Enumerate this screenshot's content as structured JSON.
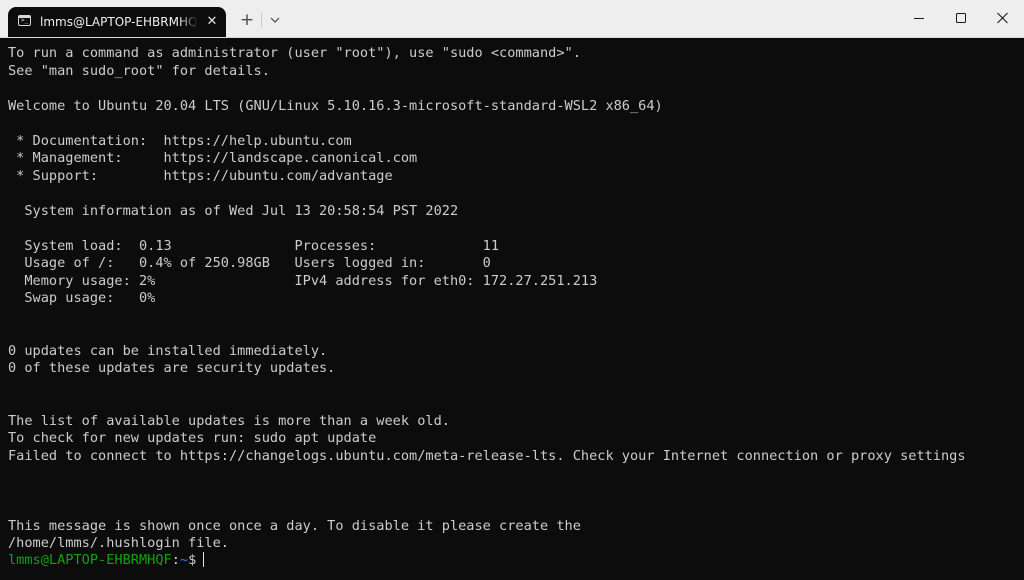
{
  "window": {
    "tab_title": "lmms@LAPTOP-EHBRMHQF: ~",
    "tab_icon": "terminal-icon",
    "tab_close_icon": "close-icon",
    "new_tab_icon": "plus-icon",
    "dropdown_icon": "chevron-down-icon",
    "controls": [
      "minimize-icon",
      "maximize-icon",
      "close-icon"
    ]
  },
  "terminal": {
    "lines": [
      "To run a command as administrator (user \"root\"), use \"sudo <command>\".",
      "See \"man sudo_root\" for details.",
      "",
      "Welcome to Ubuntu 20.04 LTS (GNU/Linux 5.10.16.3-microsoft-standard-WSL2 x86_64)",
      "",
      " * Documentation:  https://help.ubuntu.com",
      " * Management:     https://landscape.canonical.com",
      " * Support:        https://ubuntu.com/advantage",
      "",
      "  System information as of Wed Jul 13 20:58:54 PST 2022",
      "",
      "  System load:  0.13               Processes:             11",
      "  Usage of /:   0.4% of 250.98GB   Users logged in:       0",
      "  Memory usage: 2%                 IPv4 address for eth0: 172.27.251.213",
      "  Swap usage:   0%",
      "",
      "",
      "0 updates can be installed immediately.",
      "0 of these updates are security updates.",
      "",
      "",
      "The list of available updates is more than a week old.",
      "To check for new updates run: sudo apt update",
      "Failed to connect to https://changelogs.ubuntu.com/meta-release-lts. Check your Internet connection or proxy settings",
      "",
      "",
      "",
      "This message is shown once once a day. To disable it please create the",
      "/home/lmms/.hushlogin file."
    ],
    "prompt": {
      "user_host": "lmms@LAPTOP-EHBRMHQF",
      "separator": ":",
      "path": "~",
      "symbol": "$"
    }
  },
  "colors": {
    "background": "#0c0c0c",
    "foreground": "#cccccc",
    "prompt_user": "#13a10e",
    "prompt_path": "#3b78ff",
    "titlebar": "#eeeeee"
  }
}
